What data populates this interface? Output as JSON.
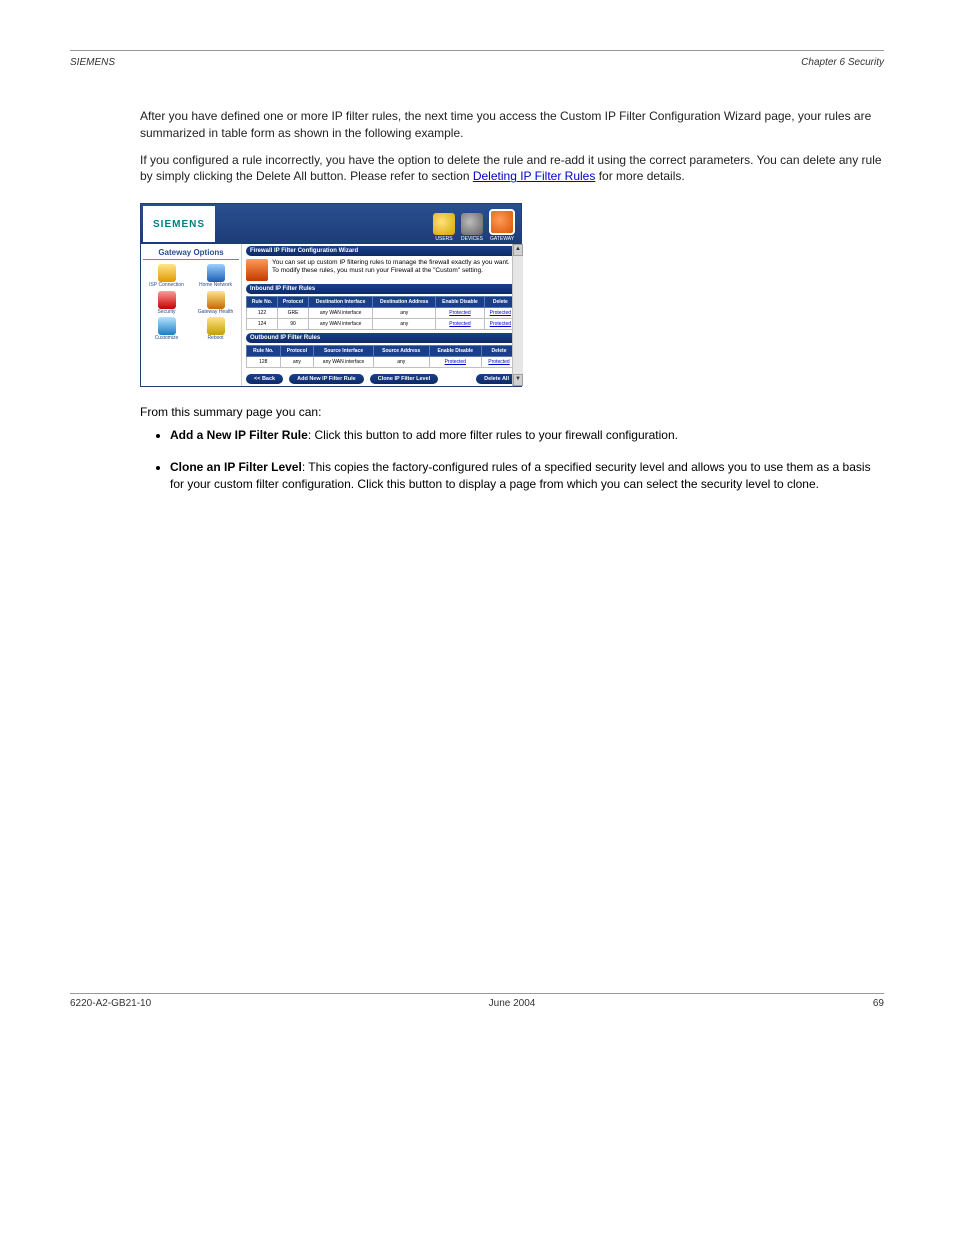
{
  "header": {
    "left": "SIEMENS",
    "right": "Chapter 6  Security"
  },
  "intro": {
    "p1": "After you have defined one or more IP filter rules, the next time you access the Custom IP Filter Configuration Wizard page, your rules are summarized in table form as shown in the following example.",
    "p2_before": "If you configured a rule incorrectly, you have the option to delete the rule and re-add it using the correct parameters. You can delete any rule by simply clicking the Delete All button. Please refer to section ",
    "p2_link": "Deleting IP Filter Rules",
    "p2_after": " for more details.",
    "from": "From this summary page you can:"
  },
  "screenshot": {
    "logo": "SIEMENS",
    "topnav": {
      "users": "USERS",
      "devices": "DEVICES",
      "gateway": "GATEWAY"
    },
    "sidebar": {
      "title": "Gateway Options",
      "items": {
        "isp": "ISP Connection",
        "home": "Home Network",
        "security": "Security",
        "gwhealth": "Gateway Health",
        "customize": "Customize",
        "reboot": "Reboot"
      }
    },
    "main": {
      "bar1": "Firewall IP Filter Configuration Wizard",
      "desc": "You can set up custom IP filtering rules to manage the firewall exactly as you want. To modify these rules, you must run your Firewall at the \"Custom\" setting.",
      "bar_in": "Inbound IP Filter Rules",
      "bar_out": "Outbound IP Filter Rules",
      "headers_in": [
        "Rule No.",
        "Protocol",
        "Destination Interface",
        "Destination Address",
        "Enable Disable",
        "Delete"
      ],
      "rows_in": [
        [
          "122",
          "GRE",
          "any WAN interface",
          "any",
          "Protected",
          "Protected"
        ],
        [
          "124",
          "90",
          "any WAN interface",
          "any",
          "Protected",
          "Protected"
        ]
      ],
      "headers_out": [
        "Rule No.",
        "Protocol",
        "Source Interface",
        "Source Address",
        "Enable Disable",
        "Delete"
      ],
      "rows_out": [
        [
          "128",
          "any",
          "any WAN interface",
          "any",
          "Protected",
          "Protected"
        ]
      ],
      "btn_back": "<< Back",
      "btn_add": "Add New IP Filter Rule",
      "btn_clone": "Clone IP Filter Level",
      "btn_delete": "Delete All"
    }
  },
  "choices": {
    "item1_bold": "Add a New IP Filter Rule",
    "item1_rest": ": Click this button to add more filter rules to your firewall configuration.",
    "item2_bold": "Clone an IP Filter Level",
    "item2_rest": ": This copies the factory-configured rules of a specified security level and allows you to use them as a basis for your custom filter configuration. Click this button to display a page from which you can select the security level to clone."
  },
  "footer": {
    "left": "6220-A2-GB21-10",
    "center": "June 2004",
    "right": "69"
  }
}
